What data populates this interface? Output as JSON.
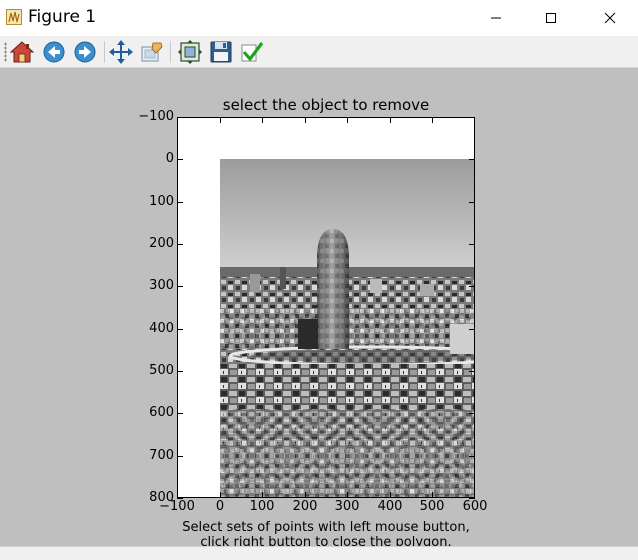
{
  "window": {
    "title": "Figure 1",
    "icon": "matplotlib-figure-icon",
    "controls": [
      "minimize-icon",
      "maximize-icon",
      "close-icon"
    ]
  },
  "toolbar": {
    "items": [
      {
        "name": "home",
        "icon": "home-icon"
      },
      {
        "name": "back",
        "icon": "back-arrow-icon"
      },
      {
        "name": "forward",
        "icon": "forward-arrow-icon"
      },
      {
        "name": "pan",
        "icon": "pan-arrows-icon"
      },
      {
        "name": "zoom",
        "icon": "zoom-rect-icon"
      },
      {
        "name": "subplots",
        "icon": "configure-subplots-icon"
      },
      {
        "name": "save",
        "icon": "save-disk-icon"
      },
      {
        "name": "edit",
        "icon": "checkmark-icon"
      }
    ]
  },
  "figure": {
    "title": "select the object to remove",
    "caption_line1": "Select sets of  points with left mouse button,",
    "caption_line2": "click right button to close the polygon.",
    "y_ticks": [
      "−100",
      "0",
      "100",
      "200",
      "300",
      "400",
      "500",
      "600",
      "700",
      "800"
    ],
    "x_ticks": [
      "−100",
      "0",
      "100",
      "200",
      "300",
      "400",
      "500",
      "600"
    ],
    "xlim": [
      -100,
      600
    ],
    "ylim": [
      800,
      -100
    ],
    "image_extent": {
      "x": [
        0,
        600
      ],
      "y": [
        0,
        800
      ]
    },
    "image": "grayscale-photo-city-skyline-tower"
  },
  "colors": {
    "background": "#bfbfbf",
    "toolbar": "#f0f0f0",
    "axes_face": "#ffffff"
  }
}
